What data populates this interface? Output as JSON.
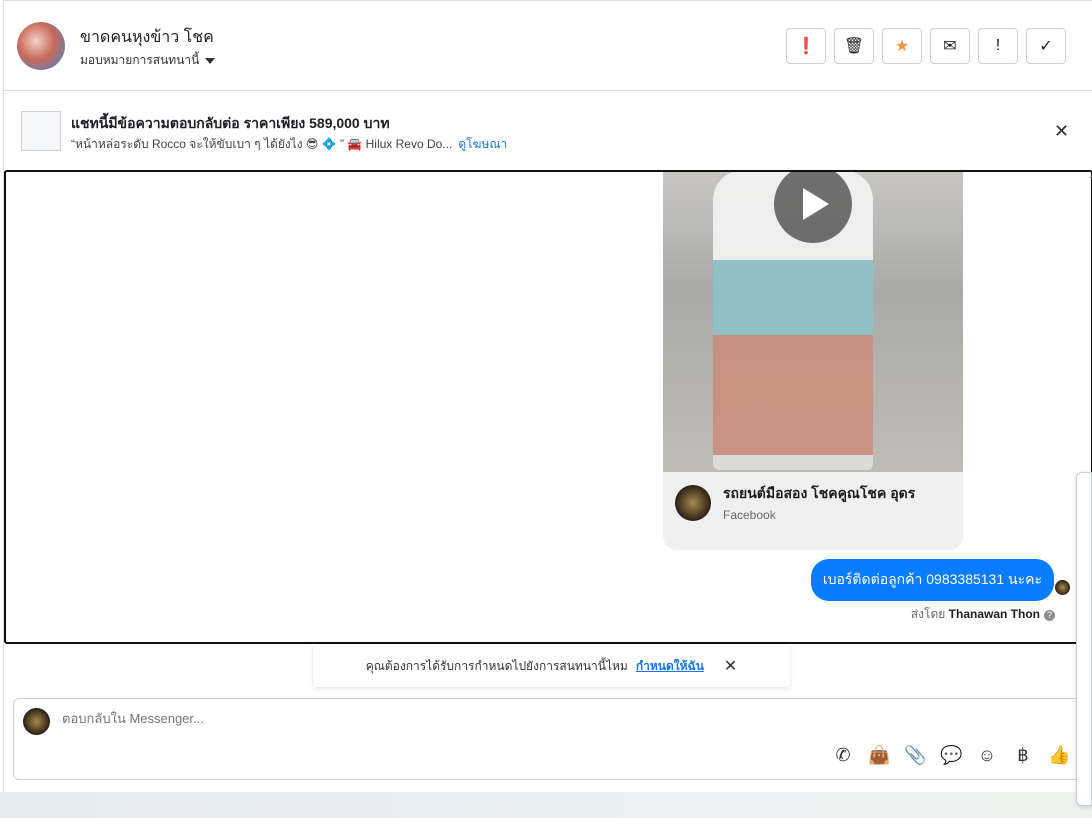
{
  "header": {
    "name": "ขาดคนหุงข้าว โชค",
    "assign_label": "มอบหมายการสนทนานี้",
    "actions": [
      {
        "icon": "alert-circle-icon",
        "glyph": "❗"
      },
      {
        "icon": "trash-icon",
        "glyph": "🗑"
      },
      {
        "icon": "star-icon",
        "glyph": "★",
        "color": "#f7923a"
      },
      {
        "icon": "envelope-icon",
        "glyph": "✉"
      },
      {
        "icon": "exclamation-icon",
        "glyph": "!"
      },
      {
        "icon": "check-icon",
        "glyph": "✓"
      }
    ]
  },
  "ad": {
    "title": "แชทนี้มีข้อความตอบกลับต่อ ราคาเพียง 589,000 บาท",
    "subtitle": "“หน้าหล่อระดับ Rocco จะให้ขับเบา ๆ ได้ยังไง 😎 💠 ” 🚘 Hilux Revo Do...",
    "link": "ดูโฆษณา"
  },
  "chat": {
    "card": {
      "page_name": "รถยนต์มือสอง โชคคูณโชค อุดร",
      "source": "Facebook"
    },
    "message": "เบอร์ติดต่อลูกค้า 0983385131 นะคะ",
    "sent_by_label": "ส่งโดย",
    "sent_by": "Thanawan Thon",
    "accent": "#0a7cff"
  },
  "toast": {
    "text": "คุณต้องการได้รับการกำหนดไปยังการสนทนานี้ไหม",
    "link": "กำหนดให้ฉัน"
  },
  "composer": {
    "placeholder": "ตอบกลับใน Messenger...",
    "tools": [
      {
        "icon": "phone-add-icon",
        "glyph": "✆"
      },
      {
        "icon": "shopping-bag-icon",
        "glyph": "👜"
      },
      {
        "icon": "paperclip-icon",
        "glyph": "📎"
      },
      {
        "icon": "chat-bubble-icon",
        "glyph": "💬"
      },
      {
        "icon": "emoji-icon",
        "glyph": "☺"
      },
      {
        "icon": "baht-icon",
        "glyph": "฿"
      },
      {
        "icon": "thumbs-up-icon",
        "glyph": "👍"
      }
    ]
  }
}
